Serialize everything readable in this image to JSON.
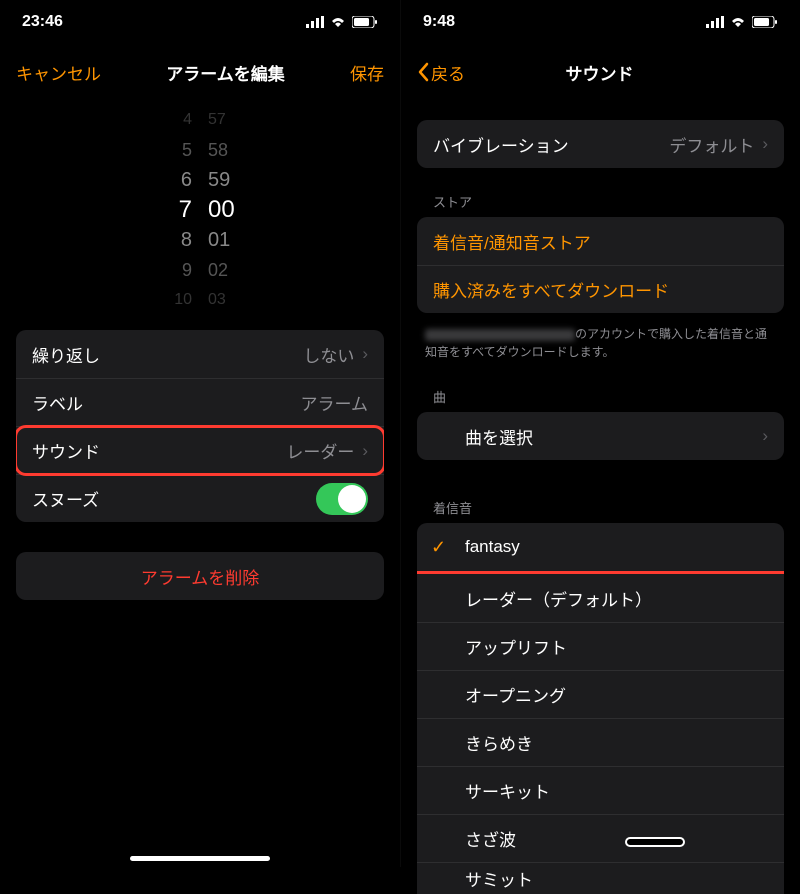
{
  "left": {
    "status_time": "23:46",
    "nav_cancel": "キャンセル",
    "nav_title": "アラームを編集",
    "nav_save": "保存",
    "picker": {
      "hours": [
        "4",
        "5",
        "6",
        "7",
        "8",
        "9",
        "10"
      ],
      "minutes": [
        "57",
        "58",
        "59",
        "00",
        "01",
        "02",
        "03"
      ]
    },
    "cells": {
      "repeat_label": "繰り返し",
      "repeat_value": "しない",
      "label_label": "ラベル",
      "label_value": "アラーム",
      "sound_label": "サウンド",
      "sound_value": "レーダー",
      "snooze_label": "スヌーズ"
    },
    "delete_label": "アラームを削除"
  },
  "right": {
    "status_time": "9:48",
    "nav_back": "戻る",
    "nav_title": "サウンド",
    "vibration_label": "バイブレーション",
    "vibration_value": "デフォルト",
    "store_header": "ストア",
    "store_tone_store": "着信音/通知音ストア",
    "store_download_all": "購入済みをすべてダウンロード",
    "store_footer_suffix": "のアカウントで購入した着信音と通知音をすべてダウンロードします。",
    "song_header": "曲",
    "song_pick": "曲を選択",
    "ringtone_header": "着信音",
    "ringtones": [
      "fantasy",
      "レーダー（デフォルト）",
      "アップリフト",
      "オープニング",
      "きらめき",
      "サーキット",
      "さざ波",
      "サミット"
    ],
    "selected_ringtone_index": 0
  }
}
